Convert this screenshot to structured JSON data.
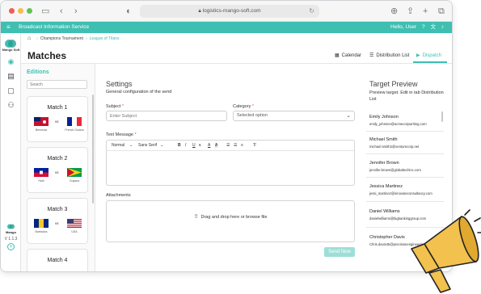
{
  "browser": {
    "url": "logistics-mango-soft.com"
  },
  "appbar": {
    "title": "Broadcast Information Service",
    "user_greeting": "Hello, User",
    "help_icon": "help-circle-icon",
    "translate_icon": "translate-icon",
    "bell_icon": "bell-icon"
  },
  "rail": {
    "brand": "Mango Soft",
    "footer_brand": "Mango",
    "version": "V 1.1.3"
  },
  "breadcrumb": {
    "items": [
      "Champions Tournament",
      "League of Titans"
    ]
  },
  "page": {
    "title": "Matches"
  },
  "tabs": [
    {
      "label": "Calendar",
      "icon": "calendar-icon"
    },
    {
      "label": "Distribution List",
      "icon": "list-icon"
    },
    {
      "label": "Dispatch",
      "icon": "send-icon",
      "active": true
    }
  ],
  "editions": {
    "title": "Editions",
    "search_placeholder": "Search",
    "matches": [
      {
        "name": "Match 1",
        "vs": "vs",
        "team_left": "Bermuda",
        "team_right": "French Guiana"
      },
      {
        "name": "Match 2",
        "vs": "vs",
        "team_left": "Haiti",
        "team_right": "Guyana"
      },
      {
        "name": "Match 3",
        "vs": "vs",
        "team_left": "Barbados",
        "team_right": "USA"
      },
      {
        "name": "Match 4",
        "vs": "vs",
        "team_left": "",
        "team_right": ""
      }
    ]
  },
  "settings": {
    "title": "Settings",
    "subtitle": "General configuration of the send",
    "subject_label": "Subject",
    "subject_placeholder": "Enter Subject",
    "category_label": "Category",
    "category_value": "Selected option",
    "required_mark": "*",
    "message_label": "Text Message",
    "toolbar": {
      "normal": "Normal",
      "font": "Sans Serif",
      "bold": "B",
      "italic": "I",
      "underline": "U",
      "color": "A",
      "highlight": "A",
      "ordered": "☰",
      "bullets": "☰",
      "align": "≡",
      "clear": "T̸"
    },
    "attachments_label": "Attachments",
    "dropzone_text": "Drag and drop here or browse file",
    "send_label": "Send Now"
  },
  "target_preview": {
    "title": "Target Preview",
    "subtitle": "Preview target. Edit in tab Distribution List",
    "people": [
      {
        "name": "Emily Johnson",
        "email": "emily_johnson@acmecorpwriting.com"
      },
      {
        "name": "Michael Smith",
        "email": "michael.smith2@venturecorp.net"
      },
      {
        "name": "Jennifer Brown",
        "email": "jennifer.brown@globaltechinc.com"
      },
      {
        "name": "Jessica Martinez",
        "email": "jessi_martinez@innovateconsultancy.com"
      },
      {
        "name": "Daniel Williams",
        "email": "danielwilliams@bigbankinggroup.com"
      },
      {
        "name": "Christopher Davis",
        "email": "Chris.davis45@precisionengineering.com"
      }
    ]
  },
  "colors": {
    "accent": "#3ebfb2",
    "megaphone": "#f2c14e"
  }
}
